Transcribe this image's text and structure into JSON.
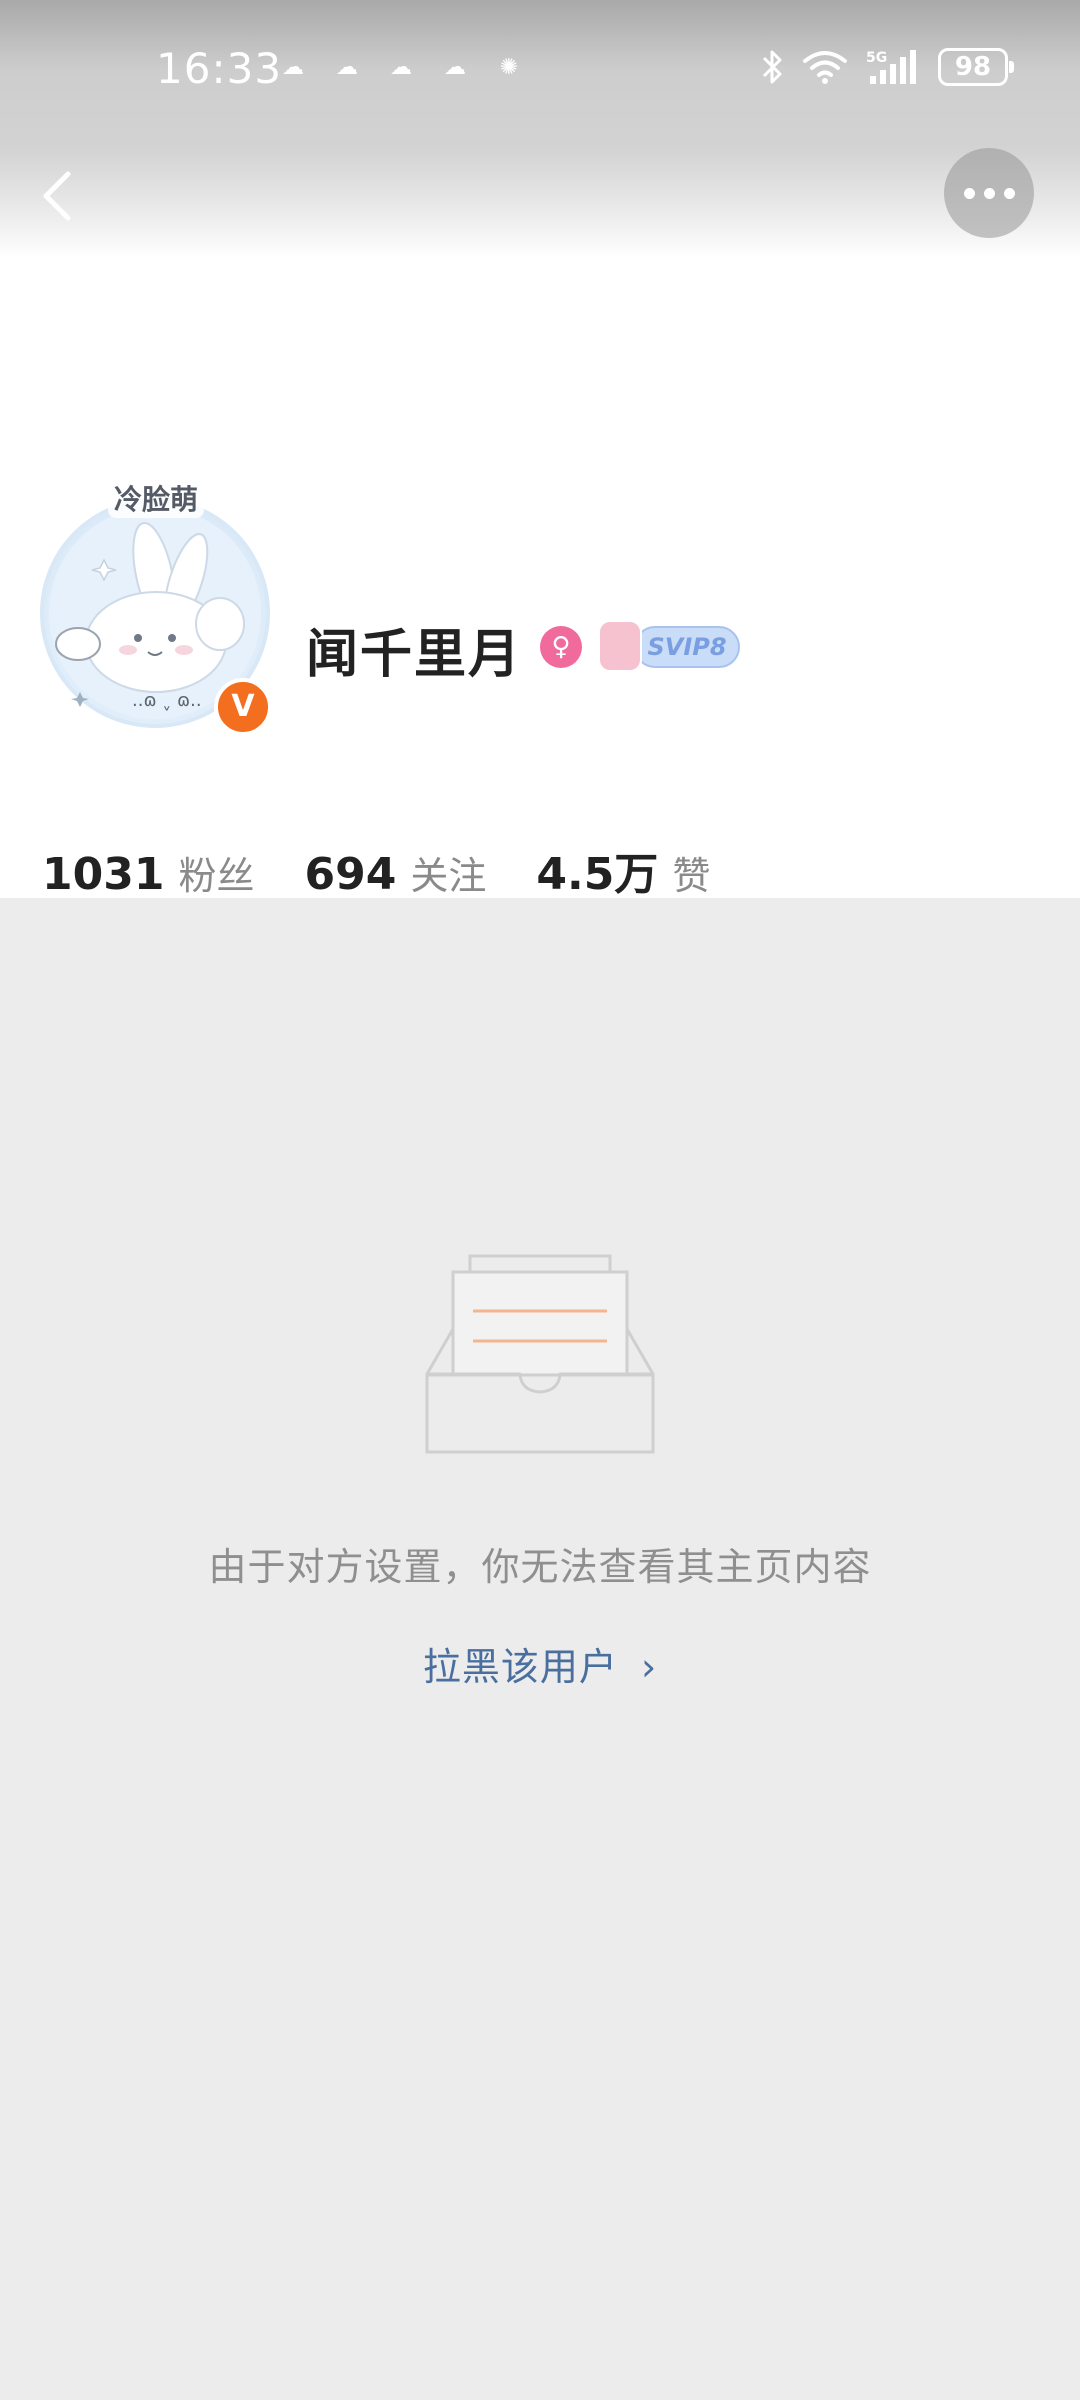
{
  "status_bar": {
    "time": "16:33",
    "notification_icons": [
      "cloud-icon",
      "cloud-icon",
      "cloud-icon",
      "cloud-icon",
      "sun-icon"
    ],
    "network": "5G",
    "battery": "98"
  },
  "profile": {
    "avatar_caption": "冷脸萌",
    "verified_badge": "V",
    "name": "闻千里月",
    "gender_icon": "female-icon",
    "vip_badge": "SVIP8"
  },
  "stats": [
    {
      "value": "1031",
      "label": "粉丝"
    },
    {
      "value": "694",
      "label": "关注"
    },
    {
      "value": "4.5万",
      "label": "赞"
    }
  ],
  "empty_state": {
    "message": "由于对方设置，你无法查看其主页内容",
    "action_label": "拉黑该用户",
    "action_chevron": "›"
  },
  "colors": {
    "accent_link": "#4a6f9e",
    "verified_orange": "#f36e1e",
    "female_pink": "#f06a9c",
    "page_bg": "#ececec"
  }
}
